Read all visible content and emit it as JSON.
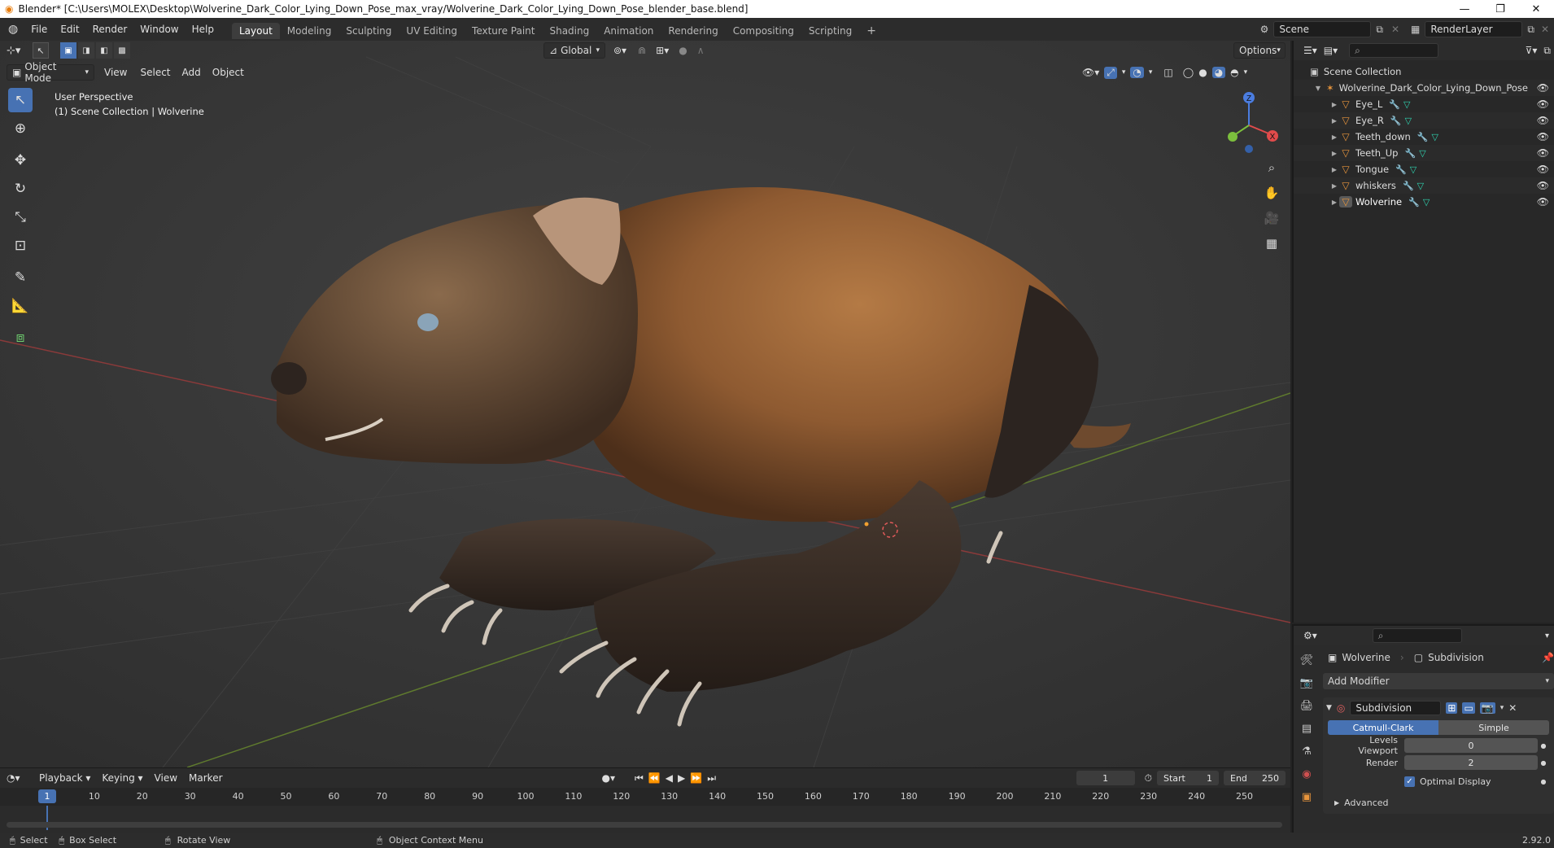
{
  "titlebar": {
    "title": "Blender* [C:\\Users\\MOLEX\\Desktop\\Wolverine_Dark_Color_Lying_Down_Pose_max_vray/Wolverine_Dark_Color_Lying_Down_Pose_blender_base.blend]",
    "minimize": "—",
    "restore": "❐",
    "close": "✕"
  },
  "menu": [
    "File",
    "Edit",
    "Render",
    "Window",
    "Help"
  ],
  "workspaces": [
    "Layout",
    "Modeling",
    "Sculpting",
    "UV Editing",
    "Texture Paint",
    "Shading",
    "Animation",
    "Rendering",
    "Compositing",
    "Scripting"
  ],
  "active_workspace": "Layout",
  "scene_field": "Scene",
  "renderlayer_field": "RenderLayer",
  "viewport_header": {
    "mode": "Object Mode",
    "view": "View",
    "select": "Select",
    "add": "Add",
    "object": "Object",
    "orientation": "Global",
    "options": "Options"
  },
  "viewport_overlay": {
    "line1": "User Perspective",
    "line2": "(1) Scene Collection | Wolverine"
  },
  "gizmo": {
    "z": "Z",
    "x": "X"
  },
  "outliner": {
    "root": "Scene Collection",
    "collection": "Wolverine_Dark_Color_Lying_Down_Pose",
    "objects": [
      "Eye_L",
      "Eye_R",
      "Teeth_down",
      "Teeth_Up",
      "Tongue",
      "whiskers",
      "Wolverine"
    ]
  },
  "properties": {
    "object_name": "Wolverine",
    "modifier_crumb": "Subdivision",
    "add_modifier": "Add Modifier",
    "modifier_name": "Subdivision",
    "algo_catmull": "Catmull-Clark",
    "algo_simple": "Simple",
    "levels_viewport_label": "Levels Viewport",
    "levels_viewport": "0",
    "render_label": "Render",
    "render_level": "2",
    "optimal_display": "Optimal Display",
    "advanced": "Advanced"
  },
  "timeline": {
    "playback": "Playback",
    "keying": "Keying",
    "view": "View",
    "marker": "Marker",
    "current_frame": "1",
    "start_label": "Start",
    "start": "1",
    "end_label": "End",
    "end": "250",
    "ruler": [
      "10",
      "20",
      "30",
      "40",
      "50",
      "60",
      "70",
      "80",
      "90",
      "100",
      "110",
      "120",
      "130",
      "140",
      "150",
      "160",
      "170",
      "180",
      "190",
      "200",
      "210",
      "220",
      "230",
      "240",
      "250"
    ],
    "cursor_frame": "1"
  },
  "statusbar": {
    "select": "Select",
    "box_select": "Box Select",
    "rotate_view": "Rotate View",
    "context_menu": "Object Context Menu",
    "version": "2.92.0"
  },
  "colors": {
    "accent": "#4772b3",
    "object_orange": "#e8953c",
    "mesh_teal": "#2fd4b0"
  }
}
